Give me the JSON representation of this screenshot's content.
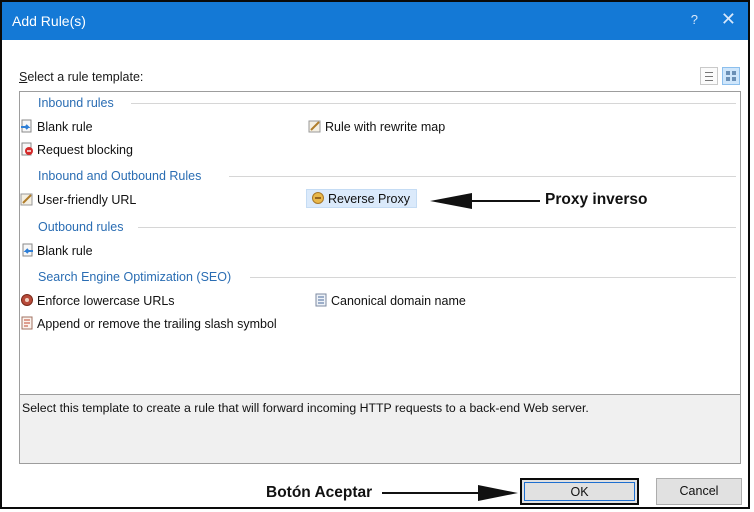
{
  "window": {
    "title": "Add Rule(s)",
    "help": "?",
    "close": "✕"
  },
  "prompt": {
    "prefix": "S",
    "rest": "elect a rule template:"
  },
  "groups": {
    "inbound": "Inbound rules",
    "inout": "Inbound and Outbound Rules",
    "outbound": "Outbound rules",
    "seo": "Search Engine Optimization (SEO)"
  },
  "items": {
    "blank_in": "Blank rule",
    "rewrite_map": "Rule with rewrite map",
    "request_blocking": "Request blocking",
    "user_friendly": "User-friendly URL",
    "reverse_proxy": "Reverse Proxy",
    "blank_out": "Blank rule",
    "lowercase": "Enforce lowercase URLs",
    "canonical": "Canonical domain name",
    "trailing_slash": "Append or remove the trailing slash symbol"
  },
  "description": "Select this template to create a rule that will forward incoming HTTP requests to a back-end Web server.",
  "buttons": {
    "ok": "OK",
    "cancel": "Cancel"
  },
  "annotations": {
    "proxy": "Proxy inverso",
    "accept": "Botón Aceptar"
  },
  "colors": {
    "titlebar": "#1479d6",
    "group_text": "#2a6db3",
    "selection": "#dbeafb"
  }
}
